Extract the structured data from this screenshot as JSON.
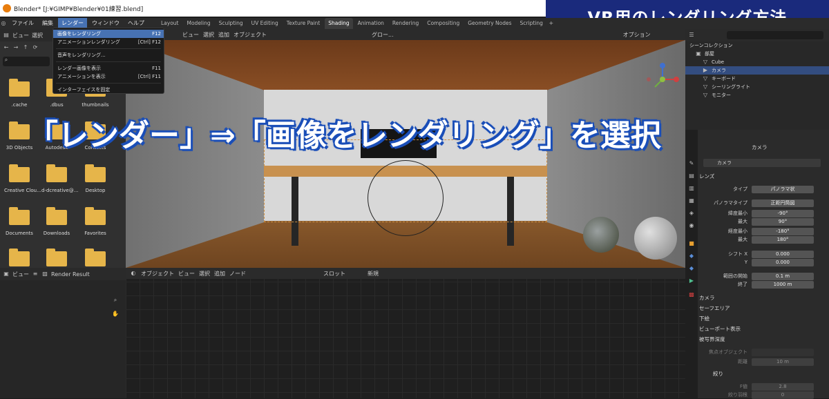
{
  "window_title": "Blender* [J:¥GIMP¥Blender¥01練習.blend]",
  "banner": "VR用のレンダリング方法",
  "overlay_caption": "「レンダー」⇒「画像をレンダリング」を選択",
  "menu": [
    "ファイル",
    "編集",
    "レンダー",
    "ウィンドウ",
    "ヘルプ"
  ],
  "workspace_tabs": [
    "Layout",
    "Modeling",
    "Sculpting",
    "UV Editing",
    "Texture Paint",
    "Shading",
    "Animation",
    "Rendering",
    "Compositing",
    "Geometry Nodes",
    "Scripting"
  ],
  "render_menu": [
    {
      "label": "画像をレンダリング",
      "shortcut": "F12"
    },
    {
      "label": "アニメーションレンダリング",
      "shortcut": "[Ctrl] F12"
    },
    {
      "label": "音声をレンダリング...",
      "shortcut": ""
    },
    {
      "label": "レンダー画像を表示",
      "shortcut": "F11"
    },
    {
      "label": "アニメーションを表示",
      "shortcut": "[Ctrl] F11"
    },
    {
      "label": "インターフェイスを固定",
      "shortcut": ""
    }
  ],
  "file_browser": {
    "view_label": "ビュー",
    "select_label": "選択",
    "folders": [
      ".cache",
      ".dbus",
      "thumbnails",
      "3D Objects",
      "Autodesk",
      "Contacts",
      "Creative Clou...",
      "d-dcreative@...",
      "Desktop",
      "Documents",
      "Downloads",
      "Favorites"
    ]
  },
  "viewport_header": {
    "view": "ビュー",
    "select": "選択",
    "add": "追加",
    "object": "オブジェクト",
    "global": "グロー...",
    "options": "オプション"
  },
  "image_editor": {
    "view": "ビュー",
    "title": "Render Result"
  },
  "node_editor": {
    "mode": "オブジェクト",
    "view": "ビュー",
    "select": "選択",
    "add": "追加",
    "node": "ノード",
    "slot": "スロット",
    "new": "新規"
  },
  "outliner": {
    "title": "シーンコレクション",
    "items": [
      "部屋",
      "Cube",
      "カメラ",
      "キーボード",
      "シーリングライト",
      "モニター"
    ]
  },
  "properties": {
    "object": "カメラ",
    "data": "カメラ",
    "lens_section": "レンズ",
    "rows": [
      {
        "key": "タイプ",
        "value": "パノラマ状"
      },
      {
        "key": "パノラマタイプ",
        "value": "正距円筒図"
      },
      {
        "key": "緯度最小",
        "value": "-90°"
      },
      {
        "key": "最大",
        "value": "90°"
      },
      {
        "key": "経度最小",
        "value": "-180°"
      },
      {
        "key": "最大",
        "value": "180°"
      },
      {
        "key": "シフト X",
        "value": "0.000"
      },
      {
        "key": "Y",
        "value": "0.000"
      },
      {
        "key": "範囲の開始",
        "value": "0.1 m"
      },
      {
        "key": "終了",
        "value": "1000 m"
      }
    ],
    "sections": [
      "カメラ",
      "セーフエリア",
      "下絵",
      "ビューポート表示",
      "被写界深度"
    ],
    "dof": {
      "focus_label": "焦点オブジェクト",
      "distance_label": "距離",
      "distance": "10 m",
      "aperture": "絞り",
      "fstop_label": "F値",
      "fstop": "2.8",
      "blades_label": "絞り羽根",
      "blades": "0"
    }
  },
  "colors": {
    "accent": "#4772b3",
    "banner": "#1a2a7c",
    "caption_outline": "#1b4fb8",
    "folder": "#e6b54a"
  }
}
